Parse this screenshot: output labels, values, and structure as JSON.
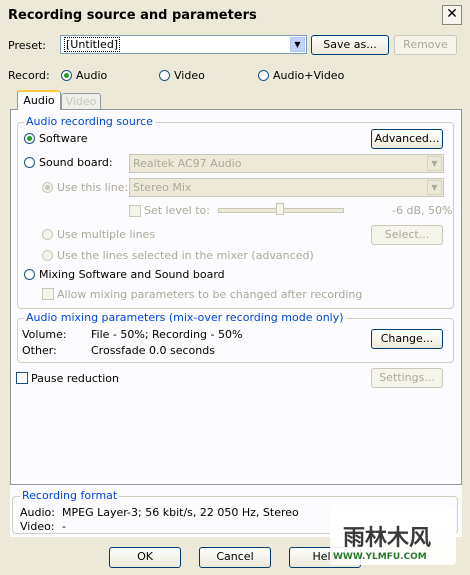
{
  "window": {
    "title": "Recording source and parameters",
    "close": "✕"
  },
  "preset": {
    "label": "Preset:",
    "value": "[Untitled]",
    "save_as": "Save as...",
    "remove": "Remove"
  },
  "record": {
    "label": "Record:",
    "audio": "Audio",
    "video": "Video",
    "audio_video": "Audio+Video",
    "selected": "Audio"
  },
  "tabs": [
    {
      "label": "Audio",
      "active": true
    },
    {
      "label": "Video",
      "active": false
    }
  ],
  "audio_source": {
    "title": "Audio recording source",
    "software": "Software",
    "advanced": "Advanced...",
    "sound_board": "Sound board:",
    "sound_board_value": "Realtek AC97 Audio",
    "use_this_line": "Use this line:",
    "line_value": "Stereo Mix",
    "set_level_to": "Set level to:",
    "level_value": "-6 dB, 50%",
    "level_fraction": 0.5,
    "use_multiple_lines": "Use multiple lines",
    "select": "Select...",
    "use_lines_mixer": "Use the lines selected in the mixer (advanced)",
    "mixing": "Mixing Software and Sound board",
    "allow_mixing": "Allow mixing parameters to be changed after recording"
  },
  "mixing_params": {
    "title": "Audio mixing parameters (mix-over recording mode only)",
    "volume_label": "Volume:",
    "volume_value": "File - 50%; Recording - 50%",
    "other_label": "Other:",
    "other_value": "Crossfade 0.0 seconds",
    "change": "Change..."
  },
  "pause": {
    "label": "Pause reduction",
    "settings": "Settings..."
  },
  "format": {
    "title": "Recording format",
    "audio_label": "Audio:",
    "audio_value": "MPEG Layer-3; 56 kbit/s, 22 050 Hz, Stereo",
    "video_label": "Video:",
    "video_value": "-"
  },
  "footer": {
    "ok": "OK",
    "cancel": "Cancel",
    "help": "Help"
  },
  "watermark": {
    "text": "雨林木风",
    "url": "WWW.YLMFU.COM"
  }
}
